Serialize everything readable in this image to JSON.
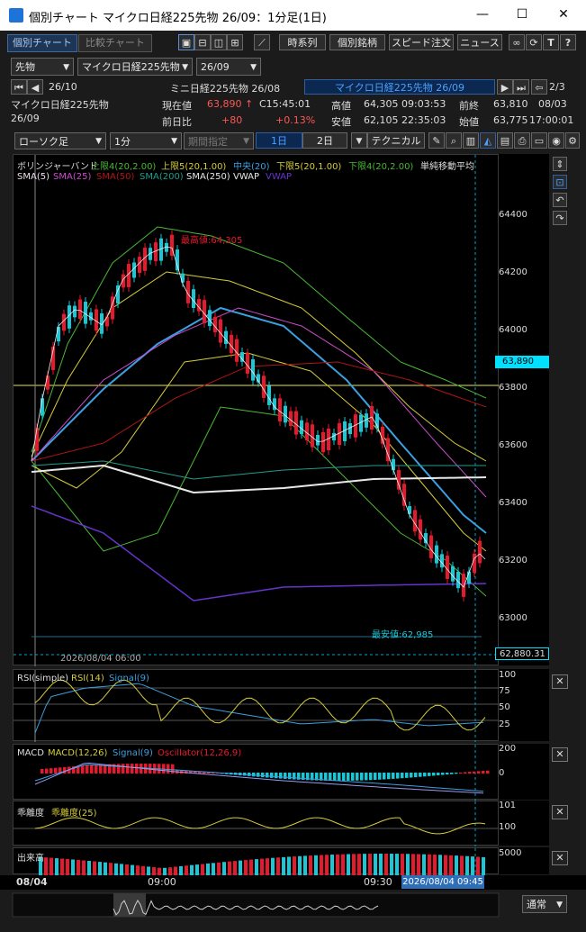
{
  "window": {
    "title": "個別チャート マイクロ日経225先物 26/09：1分足(1日)",
    "min": "—",
    "max": "☐",
    "close": "✕"
  },
  "tabs": {
    "single": "個別チャート",
    "compare": "比較チャート"
  },
  "toolbar1": {
    "timeseries": "時系列",
    "stock": "個別銘柄",
    "speed_order": "スピード注文",
    "news": "ニュース"
  },
  "selectors": {
    "market": "先物",
    "symbol": "マイクロ日経225先物",
    "month": "26/09"
  },
  "contracts": {
    "left": "26/10",
    "middle": "ミニ日経225先物 26/08",
    "active": "マイクロ日経225先物 26/09",
    "page": "2/3"
  },
  "quote": {
    "name": "マイクロ日経225先物",
    "month": "26/09",
    "current_label": "現在値",
    "current": "63,890",
    "current_arrow": "↑",
    "current_time": "C15:45:01",
    "high_label": "高値",
    "high": "64,305",
    "high_time": "09:03:53",
    "prev_label": "前終",
    "prev": "63,810",
    "prev_date": "08/03",
    "change_label": "前日比",
    "change": "+80",
    "change_pct": "+0.13%",
    "low_label": "安値",
    "low": "62,105",
    "low_time": "22:35:03",
    "open_label": "始値",
    "open": "63,775",
    "open_time": "17:00:01"
  },
  "toolbar2": {
    "chart_type": "ローソク足",
    "interval": "1分",
    "period": "期間指定",
    "day1": "1日",
    "day2": "2日",
    "technical": "テクニカル"
  },
  "main_legend": {
    "bb": "ボリンジャーバンド",
    "up4": "上限4(20,2.00)",
    "up5": "上限5(20,1.00)",
    "mid": "中央(20)",
    "low5": "下限5(20,1.00)",
    "low4": "下限4(20,2.00)",
    "sma_title": "単純移動平均",
    "sma5": "SMA(5)",
    "sma25": "SMA(25)",
    "sma50": "SMA(50)",
    "sma200": "SMA(200)",
    "sma250": "SMA(250)",
    "vwap1": "VWAP",
    "vwap2": "VWAP"
  },
  "main_chart": {
    "y_ticks": [
      "64400",
      "64200",
      "64000",
      "63800",
      "63600",
      "63400",
      "63200",
      "63000"
    ],
    "current_price_tag": "63,890",
    "cursor_price_tag": "62,880.31",
    "high_annotation": "最高値:64,305",
    "low_annotation": "最安値:62,985",
    "crosshair_time": "2026/08/04 06:00"
  },
  "rsi": {
    "title": "RSI(simple)",
    "rsi": "RSI(14)",
    "signal": "Signal(9)",
    "ticks": [
      "100",
      "75",
      "50",
      "25"
    ]
  },
  "macd": {
    "title": "MACD",
    "macd": "MACD(12,26)",
    "signal": "Signal(9)",
    "osc": "Oscillator(12,26,9)",
    "ticks": [
      "200",
      "0"
    ]
  },
  "kairi": {
    "title": "乖離度",
    "line": "乖離度(25)",
    "ticks": [
      "101",
      "100"
    ]
  },
  "volume": {
    "title": "出来高",
    "ticks": [
      "5000"
    ]
  },
  "time_axis": {
    "date": "08/04",
    "t1": "09:00",
    "t2": "09:30",
    "cursor": "2026/08/04 09:45"
  },
  "bottom": {
    "normal": "通常"
  },
  "colors": {
    "bg": "#000000",
    "up_candle": "#e8192c",
    "down_candle": "#19c7d6",
    "bb_outer": "#4ab835",
    "bb_inner": "#d6cc3a",
    "bb_mid": "#3ba0e0",
    "sma25": "#cc4ccc",
    "sma50": "#b01515",
    "sma200": "#1f9c8c",
    "sma250": "#e8e8e8",
    "vwap": "#6633cc",
    "highlight": "#00e0ff"
  }
}
